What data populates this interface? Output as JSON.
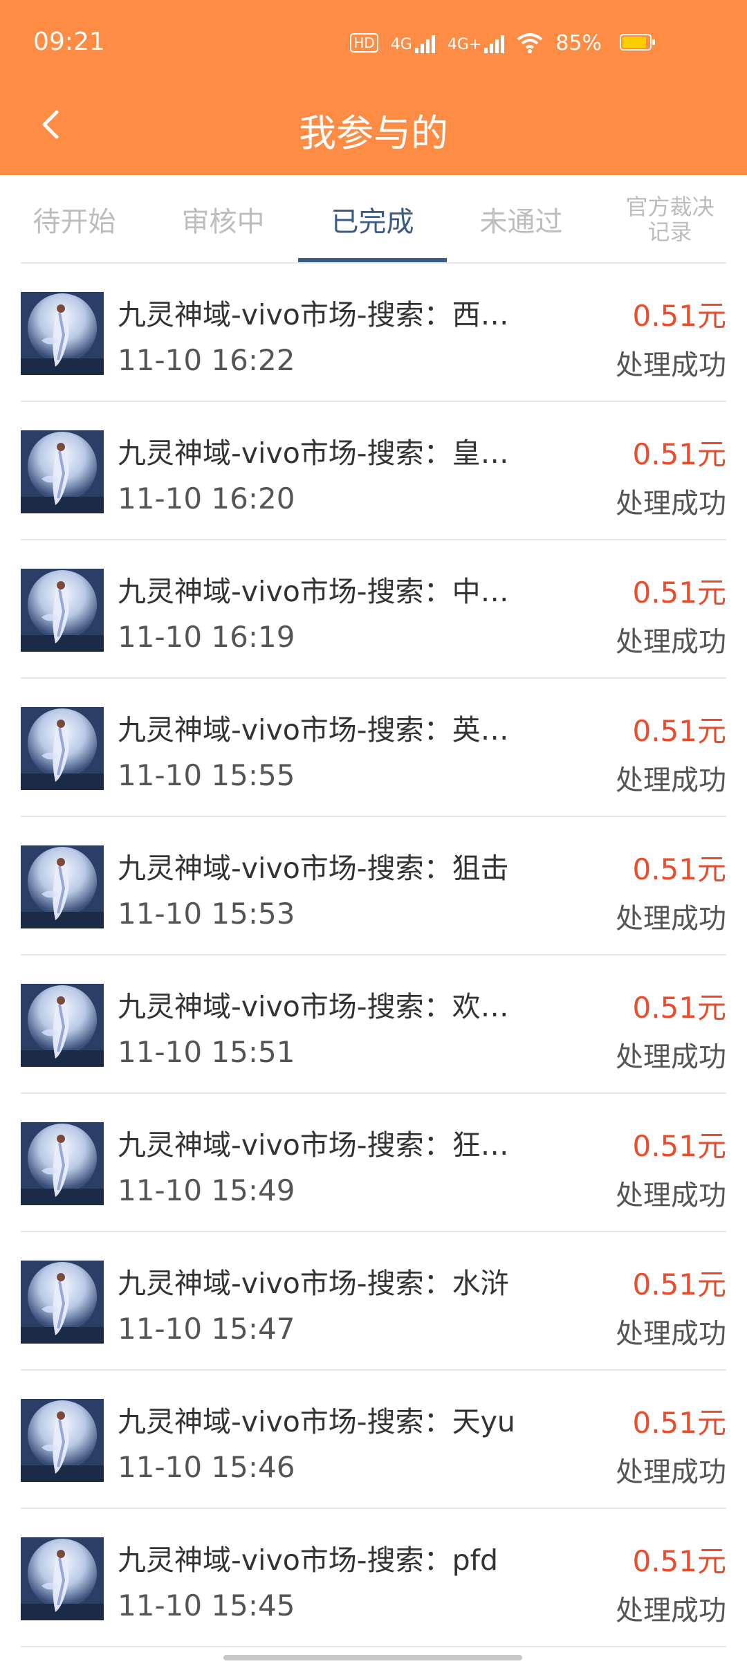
{
  "status_bar": {
    "time": "09:21",
    "hd": "HD",
    "network1": "4G",
    "network2": "4G+",
    "battery": "85%"
  },
  "header": {
    "title": "我参与的",
    "back_icon": "chevron-left-icon"
  },
  "tabs": [
    {
      "label": "待开始"
    },
    {
      "label": "审核中"
    },
    {
      "label": "已完成",
      "active": true
    },
    {
      "label": "未通过"
    },
    {
      "label": "官方裁决\n记录"
    }
  ],
  "colors": {
    "header": "#ff8c45",
    "active_tab": "#3c5a86",
    "amount": "#ee4b2b"
  },
  "items": [
    {
      "name": "九灵神域-vivo市场-搜索：西…",
      "time": "11-10 16:22",
      "amount": "0.51元",
      "status": "处理成功"
    },
    {
      "name": "九灵神域-vivo市场-搜索：皇…",
      "time": "11-10 16:20",
      "amount": "0.51元",
      "status": "处理成功"
    },
    {
      "name": "九灵神域-vivo市场-搜索：中…",
      "time": "11-10 16:19",
      "amount": "0.51元",
      "status": "处理成功"
    },
    {
      "name": "九灵神域-vivo市场-搜索：英…",
      "time": "11-10 15:55",
      "amount": "0.51元",
      "status": "处理成功"
    },
    {
      "name": "九灵神域-vivo市场-搜索：狙击",
      "time": "11-10 15:53",
      "amount": "0.51元",
      "status": "处理成功"
    },
    {
      "name": "九灵神域-vivo市场-搜索：欢…",
      "time": "11-10 15:51",
      "amount": "0.51元",
      "status": "处理成功"
    },
    {
      "name": "九灵神域-vivo市场-搜索：狂…",
      "time": "11-10 15:49",
      "amount": "0.51元",
      "status": "处理成功"
    },
    {
      "name": "九灵神域-vivo市场-搜索：水浒",
      "time": "11-10 15:47",
      "amount": "0.51元",
      "status": "处理成功"
    },
    {
      "name": "九灵神域-vivo市场-搜索：天yu",
      "time": "11-10 15:46",
      "amount": "0.51元",
      "status": "处理成功"
    },
    {
      "name": "九灵神域-vivo市场-搜索：pfd",
      "time": "11-10 15:45",
      "amount": "0.51元",
      "status": "处理成功"
    }
  ]
}
